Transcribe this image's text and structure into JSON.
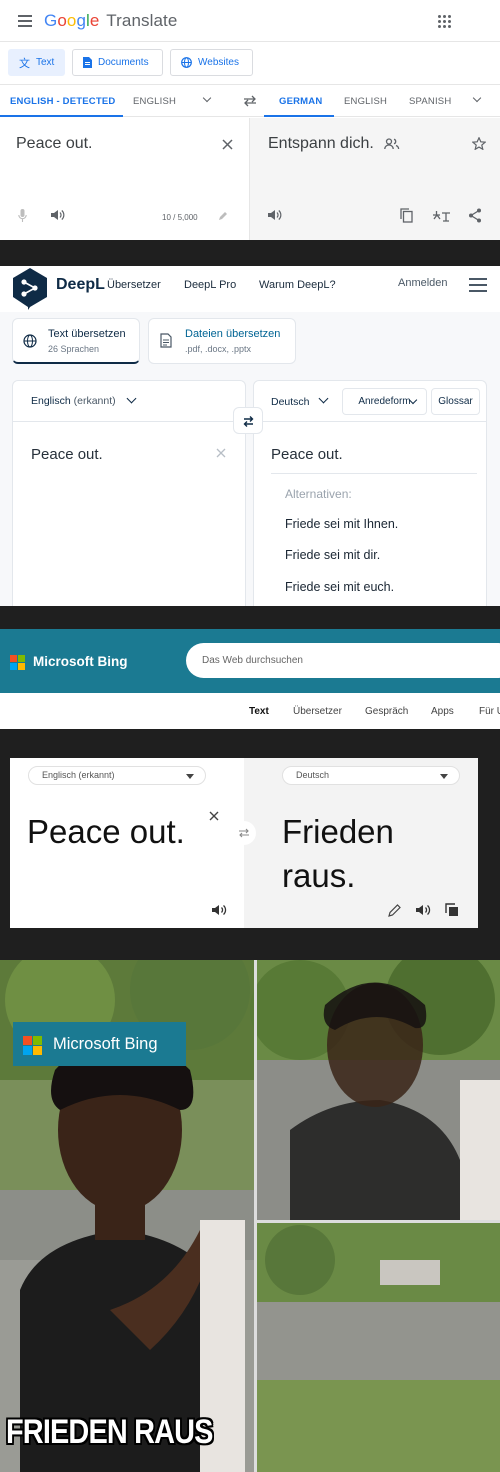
{
  "google": {
    "logo_g1": "G",
    "logo_o1": "o",
    "logo_o2": "o",
    "logo_g2": "g",
    "logo_l": "l",
    "logo_e": "e",
    "logo_suffix": "Translate",
    "modes": [
      "Text",
      "Documents",
      "Websites"
    ],
    "source_langs": [
      "ENGLISH - DETECTED",
      "ENGLISH"
    ],
    "target_langs": [
      "GERMAN",
      "ENGLISH",
      "SPANISH"
    ],
    "source_text": "Peace out.",
    "char_count": "10 / 5,000",
    "translation": "Entspann dich.",
    "colors": {
      "blue": "#1a73e8",
      "red": "#ea4335",
      "yellow": "#fbbc05",
      "green": "#34a853"
    }
  },
  "deepl": {
    "brand": "DeepL",
    "brand_sub": "Übersetzer",
    "nav": [
      "DeepL Pro",
      "Warum DeepL?"
    ],
    "login": "Anmelden",
    "tabs": [
      {
        "title": "Text übersetzen",
        "sub": "26 Sprachen"
      },
      {
        "title": "Dateien übersetzen",
        "sub": ".pdf, .docx, .pptx"
      }
    ],
    "source_lang": "Englisch",
    "source_detected": "(erkannt)",
    "target_lang": "Deutsch",
    "formality": "Anredeform",
    "glossary": "Glossar",
    "source_text": "Peace out.",
    "translation": "Peace out.",
    "alt_label": "Alternativen:",
    "alternatives": [
      "Friede sei mit Ihnen.",
      "Friede sei mit dir.",
      "Friede sei mit euch."
    ]
  },
  "bing": {
    "brand": "Microsoft Bing",
    "search_placeholder": "Das Web durchsuchen",
    "tabs": [
      "Text",
      "Übersetzer",
      "Gespräch",
      "Apps",
      "Für U"
    ],
    "source_lang": "Englisch (erkannt)",
    "target_lang": "Deutsch",
    "source_text": "Peace out.",
    "translation_line1": "Frieden",
    "translation_line2": "raus.",
    "logo_colors": [
      "#f25022",
      "#7fba00",
      "#00a4ef",
      "#ffb900"
    ]
  },
  "meme": {
    "badge": "Microsoft Bing",
    "caption": "FRIEDEN RAUS"
  }
}
